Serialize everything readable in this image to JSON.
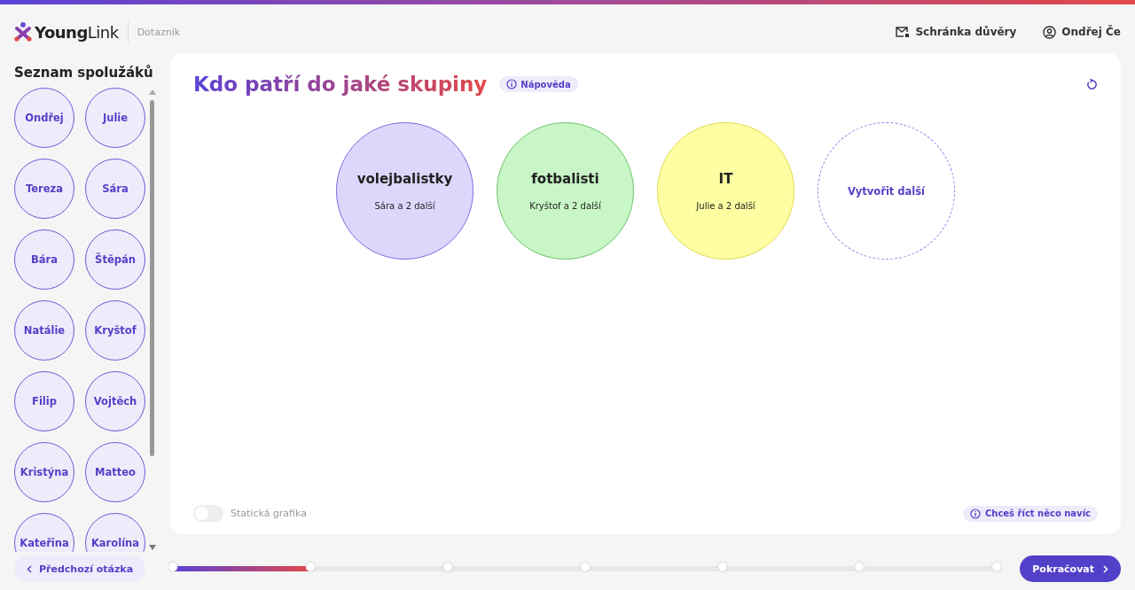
{
  "header": {
    "brand_bold": "Young",
    "brand_light": "Link",
    "section": "Dotazník",
    "links": [
      {
        "kind": "mail",
        "label": "Schránka důvěry"
      },
      {
        "kind": "user",
        "label": "Ondřej Če"
      }
    ]
  },
  "sidebar": {
    "title": "Seznam spolužáků",
    "classmates": [
      "Ondřej",
      "Julie",
      "Tereza",
      "Sára",
      "Bára",
      "Štěpán",
      "Natálie",
      "Kryštof",
      "Filip",
      "Vojtěch",
      "Kristýna",
      "Matteo",
      "Kateřina",
      "Karolína"
    ]
  },
  "question": {
    "title": "Kdo patří do jaké skupiny",
    "help": "Nápověda"
  },
  "groups": [
    {
      "kind": "group",
      "name": "volejbalistky",
      "members": "Sára a 2 další",
      "color": "#dcd8fc"
    },
    {
      "kind": "group",
      "name": "fotbalisti",
      "members": "Kryštof a 2 další",
      "color": "#c8f6c6"
    },
    {
      "kind": "group",
      "name": "IT",
      "members": "Julie a 2 další",
      "color": "#fdfda2"
    },
    {
      "kind": "new",
      "name": "Vytvořit další"
    }
  ],
  "static_toggle": {
    "label": "Statická grafika",
    "on": false
  },
  "extra": "Chceš říct něco navíc",
  "footer": {
    "back": "Předchozí otázka",
    "progress": {
      "level": 0.17
    },
    "next": "Pokračovat"
  }
}
